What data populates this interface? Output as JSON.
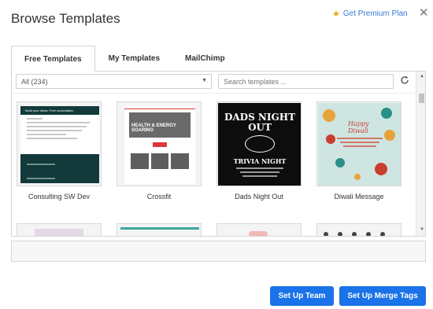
{
  "dialog": {
    "title": "Browse Templates",
    "premium_label": "Get Premium Plan",
    "close_glyph": "✕"
  },
  "tabs": [
    {
      "label": "Free Templates",
      "active": true
    },
    {
      "label": "My Templates",
      "active": false
    },
    {
      "label": "MailChimp",
      "active": false
    }
  ],
  "filter": {
    "selected": "All (234)",
    "search_placeholder": "Search templates ..."
  },
  "templates": [
    {
      "name": "Consulting SW Dev",
      "thumb_text": "Build your ideas: Free consultation"
    },
    {
      "name": "Crossfit",
      "thumb_text": "HEALTH & ENERGY SOARING"
    },
    {
      "name": "Dads Night Out",
      "thumb_text": "DADS NIGHT OUT",
      "thumb_text2": "TRIVIA NIGHT"
    },
    {
      "name": "Diwali Message",
      "thumb_text": "Happy Diwali"
    }
  ],
  "footer": {
    "setup_team": "Set Up Team",
    "setup_merge_tags": "Set Up Merge Tags"
  },
  "colors": {
    "accent": "#1a73e8",
    "link": "#3a7bd5",
    "star": "#e8a80c"
  }
}
